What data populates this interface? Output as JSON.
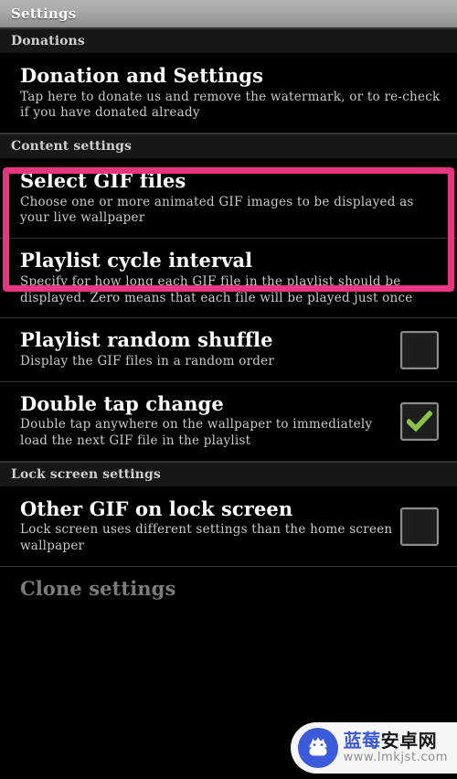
{
  "window": {
    "title": "Settings"
  },
  "colors": {
    "highlight_pink": "#e8357f",
    "checkmark_green": "#8bc34a",
    "watermark_blue": "#3b5bdb",
    "titlebar_gray": "#a8a8a8",
    "section_header_bg": "#171717"
  },
  "sections": [
    {
      "header": "Donations",
      "items": [
        {
          "title": "Donation and Settings",
          "summary": "Tap here to donate us and remove the watermark, or to re-check if you have donated already",
          "widget": "none"
        }
      ]
    },
    {
      "header": "Content settings",
      "items": [
        {
          "title": "Select GIF files",
          "summary": "Choose one or more animated GIF images to be displayed as your live wallpaper",
          "widget": "none",
          "highlighted": true
        },
        {
          "title": "Playlist cycle interval",
          "summary": "Specify for how long each GIF file in the playlist should be displayed. Zero means that each file will be played just once",
          "widget": "none"
        },
        {
          "title": "Playlist random shuffle",
          "summary": "Display the GIF files in a random order",
          "widget": "checkbox",
          "checked": false
        },
        {
          "title": "Double tap change",
          "summary": "Double tap anywhere on the wallpaper to immediately load the next GIF file in the playlist",
          "widget": "checkbox",
          "checked": true
        }
      ]
    },
    {
      "header": "Lock screen settings",
      "items": [
        {
          "title": "Other GIF on lock screen",
          "summary": "Lock screen uses different settings than the home screen wallpaper",
          "widget": "checkbox",
          "checked": false
        },
        {
          "title": "Clone settings",
          "summary": "",
          "widget": "none",
          "dimmed": true
        }
      ]
    }
  ],
  "watermark": {
    "brand_cn_blue": "蓝莓",
    "brand_cn_dark": "安卓网",
    "url": "www.lmkjst.com",
    "logo": "android-robot-icon"
  }
}
